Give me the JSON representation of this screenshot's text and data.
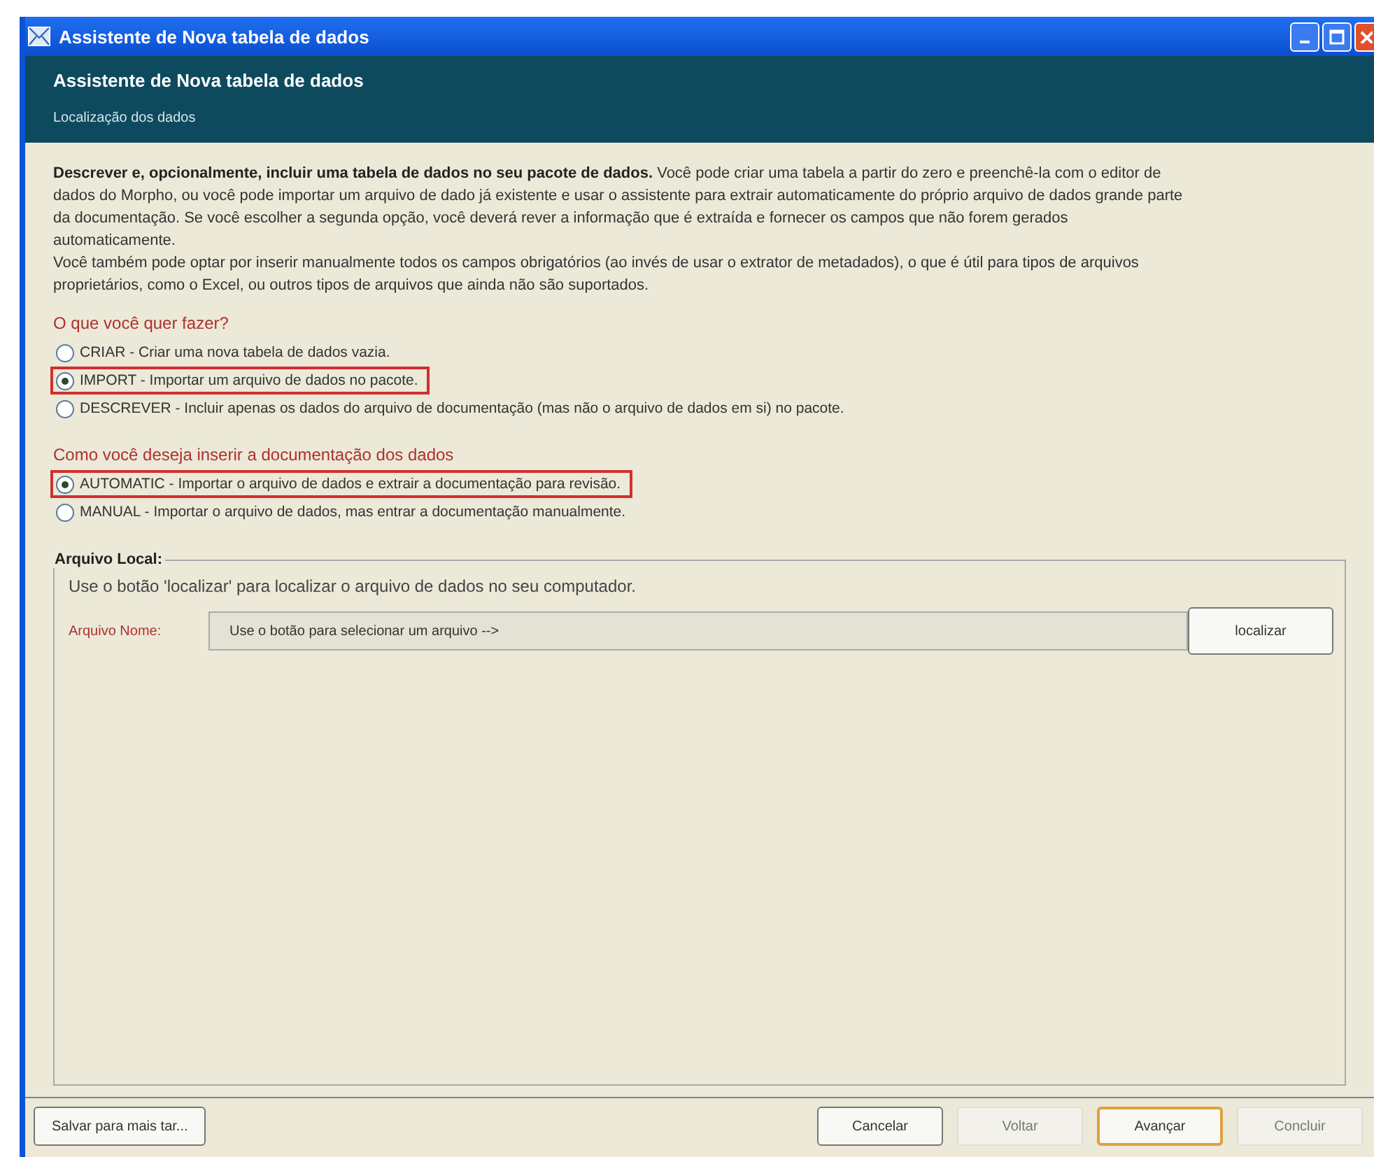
{
  "window": {
    "title": "Assistente de Nova tabela de dados"
  },
  "header": {
    "title": "Assistente de Nova tabela de dados",
    "subtitle": "Localização dos dados"
  },
  "intro": [
    "**Descrever e, opcionalmente, incluir uma tabela de dados no seu pacote de dados.** Você pode criar uma tabela a partir do zero e preenchê-la com o editor de dados do Morpho, ou você pode importar um arquivo de dado já existente e usar o assistente para extrair automaticamente do próprio arquivo de dados grande parte da documentação. Se você escolher a segunda opção, você deverá rever a informação que é extraída e fornecer os campos que não forem gerados automaticamente.",
    "Você também pode optar por inserir manualmente todos os campos obrigatórios (ao invés de usar o extrator de metadados), o que é útil para tipos de arquivos proprietários, como o Excel, ou outros tipos de arquivos que ainda não são suportados."
  ],
  "questions": [
    {
      "label": "O que você quer fazer?",
      "options": [
        {
          "label": "CRIAR - Criar uma nova tabela de dados vazia.",
          "selected": false,
          "highlighted": false
        },
        {
          "label": "IMPORT - Importar um arquivo de dados no pacote.",
          "selected": true,
          "highlighted": true
        },
        {
          "label": "DESCREVER - Incluir apenas os dados do arquivo de documentação (mas não o arquivo de dados em si) no pacote.",
          "selected": false,
          "highlighted": false
        }
      ]
    },
    {
      "label": "Como você deseja inserir a documentação dos dados",
      "options": [
        {
          "label": "AUTOMATIC - Importar o arquivo de dados e extrair a documentação para revisão.",
          "selected": true,
          "highlighted": true
        },
        {
          "label": "MANUAL - Importar o arquivo de dados, mas entrar a documentação manualmente.",
          "selected": false,
          "highlighted": false
        }
      ]
    }
  ],
  "local_file": {
    "legend": "Arquivo Local:",
    "hint": "Use o botão 'localizar' para localizar o arquivo de dados no seu computador.",
    "field_label": "Arquivo Nome:",
    "field_value": "Use o botão para selecionar um arquivo -->",
    "browse_button": "localizar"
  },
  "footer": {
    "save_button": "Salvar para mais tar...",
    "buttons": [
      {
        "label": "Cancelar",
        "disabled": false,
        "default": false
      },
      {
        "label": "Voltar",
        "disabled": true,
        "default": false
      },
      {
        "label": "Avançar",
        "disabled": false,
        "default": true
      },
      {
        "label": "Concluir",
        "disabled": true,
        "default": false
      }
    ]
  }
}
